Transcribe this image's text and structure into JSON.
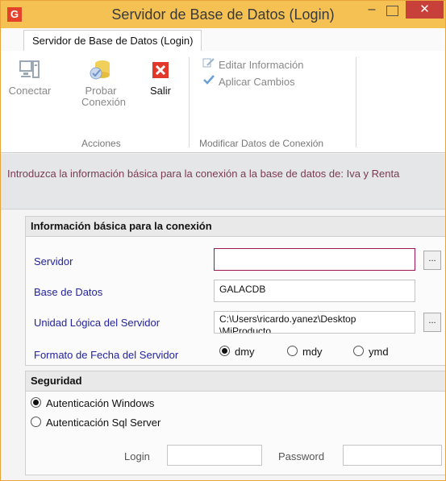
{
  "window": {
    "title": "Servidor de Base de Datos (Login)",
    "app_icon_glyph": "G",
    "minimize_glyph": "–",
    "close_glyph": "✕",
    "accent_color": "#f4c152"
  },
  "ribbon": {
    "tab_label": "Servidor de Base de Datos (Login)",
    "acciones": {
      "group_label": "Acciones",
      "conectar": "Conectar",
      "probar_line1": "Probar",
      "probar_line2": "Conexión",
      "salir": "Salir"
    },
    "modificar": {
      "group_label": "Modificar Datos de Conexión",
      "editar": "Editar Información",
      "aplicar": "Aplicar Cambios"
    }
  },
  "info": {
    "text": "Introduzca la información básica para la conexión a la base de datos de: Iva y Renta"
  },
  "basic": {
    "title": "Información básica para la conexión",
    "servidor_label": "Servidor",
    "servidor_value": "",
    "base_label": "Base de Datos",
    "base_value": "GALACDB",
    "unidad_label": "Unidad Lógica del Servidor",
    "unidad_value": "C:\\Users\\ricardo.yanez\\Desktop",
    "unidad_value_2": "\\MiProducto",
    "ellipsis": "...",
    "formato_label": "Formato de Fecha del Servidor",
    "formato_options": [
      "dmy",
      "mdy",
      "ymd"
    ],
    "formato_selected": "dmy"
  },
  "security": {
    "title": "Seguridad",
    "opt_windows": "Autenticación Windows",
    "opt_sql": "Autenticación Sql Server",
    "selected": "Autenticación Windows",
    "login_label": "Login",
    "login_value": "",
    "password_label": "Password",
    "password_value": ""
  },
  "icons": {
    "app": "galac-logo-icon",
    "conectar": "computer-icon",
    "probar": "database-check-icon",
    "salir": "exit-x-icon",
    "editar": "edit-icon",
    "aplicar": "checkmark-icon"
  }
}
